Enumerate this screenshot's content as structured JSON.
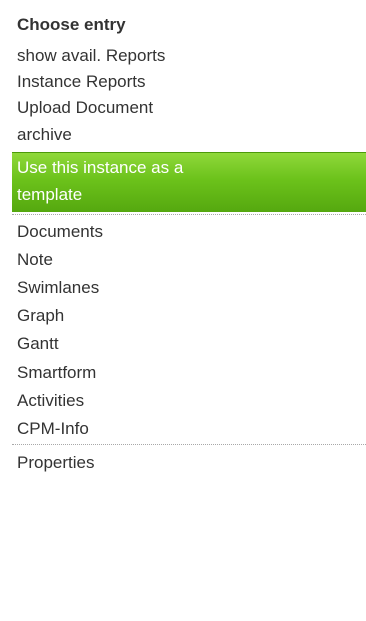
{
  "menu": {
    "header": "Choose entry",
    "group_a": [
      {
        "label": "show avail. Reports"
      },
      {
        "label": "Instance Reports"
      },
      {
        "label": "Upload Document"
      },
      {
        "label": "archive"
      }
    ],
    "active_item": {
      "line1": "Use this instance as a",
      "line2": "template"
    },
    "group_b": [
      {
        "label": "Documents"
      },
      {
        "label": "Note"
      },
      {
        "label": "Swimlanes"
      },
      {
        "label": "Graph"
      },
      {
        "label": "Gantt"
      },
      {
        "label": "Smartform"
      },
      {
        "label": "Activities"
      },
      {
        "label": "CPM-Info"
      }
    ],
    "group_c": [
      {
        "label": "Properties"
      }
    ]
  },
  "colors": {
    "text": "#333333",
    "active_bg": "#6cc21b",
    "active_text": "#ffffff",
    "divider": "#a8a8a8"
  }
}
